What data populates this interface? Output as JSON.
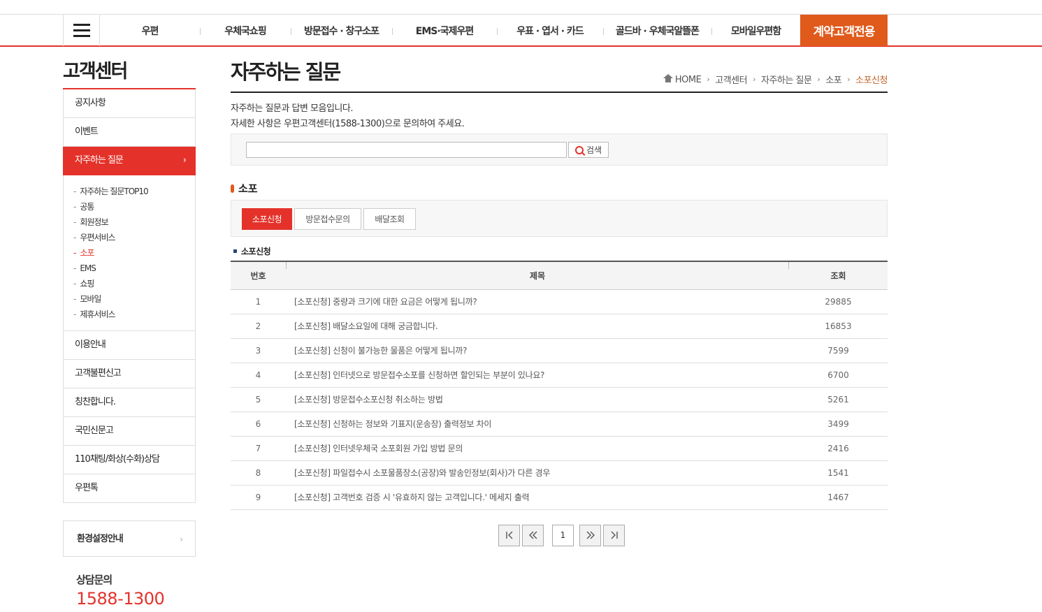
{
  "topnav": {
    "items": [
      "우편",
      "우체국쇼핑",
      "방문접수 · 창구소포",
      "EMS·국제우편",
      "우표 · 엽서 · 카드",
      "골드바 · 우체국알뜰폰",
      "모바일우편함",
      "계약고객전용"
    ]
  },
  "sidebar": {
    "title": "고객센터",
    "items_top": [
      "공지사항",
      "이벤트",
      "자주하는 질문"
    ],
    "sub_items": [
      "자주하는 질문TOP10",
      "공통",
      "회원정보",
      "우편서비스",
      "소포",
      "EMS",
      "쇼핑",
      "모바일",
      "제휴서비스"
    ],
    "items_bottom": [
      "이용안내",
      "고객불편신고",
      "칭찬합니다.",
      "국민신문고",
      "110채팅/화상(수화)상담",
      "우편톡"
    ],
    "env_label": "환경설정안내",
    "consult_label": "상담문의",
    "consult_phone": "1588-1300"
  },
  "main": {
    "title": "자주하는 질문",
    "breadcrumb": [
      "HOME",
      "고객센터",
      "자주하는 질문",
      "소포",
      "소포신청"
    ],
    "intro_1": "자주하는 질문과 답변 모음입니다.",
    "intro_2": "자세한 사항은 우편고객센터(1588-1300)으로 문의하여 주세요.",
    "search": {
      "value": "",
      "button": "검색"
    },
    "section": "소포",
    "tabs": [
      "소포신청",
      "방문접수문의",
      "배달조회"
    ],
    "subsection": "소포신청",
    "table": {
      "headers": [
        "번호",
        "제목",
        "조회"
      ],
      "rows": [
        {
          "num": "1",
          "subject": "[소포신청] 중량과 크기에 대한 요금은 어떻게 됩니까?",
          "views": "29885"
        },
        {
          "num": "2",
          "subject": "[소포신청] 배달소요일에 대해 궁금합니다.",
          "views": "16853"
        },
        {
          "num": "3",
          "subject": "[소포신청] 신청이 불가능한 물품은 어떻게 됩니까?",
          "views": "7599"
        },
        {
          "num": "4",
          "subject": "[소포신청] 인터넷으로 방문접수소포를 신청하면 할인되는 부분이 있나요?",
          "views": "6700"
        },
        {
          "num": "5",
          "subject": "[소포신청] 방문접수소포신청 취소하는 방법",
          "views": "5261"
        },
        {
          "num": "6",
          "subject": "[소포신청] 신청하는 정보와 기표지(운송장) 출력정보 차이",
          "views": "3499"
        },
        {
          "num": "7",
          "subject": "[소포신청] 인터넷우체국 소포회원 가입 방법 문의",
          "views": "2416"
        },
        {
          "num": "8",
          "subject": "[소포신청] 파일접수시 소포물품장소(공장)와 발송인정보(회사)가 다른 경우",
          "views": "1541"
        },
        {
          "num": "9",
          "subject": "[소포신청] 고객번호 검증 시 '유효하지 않는 고객입니다.' 메세지 출력",
          "views": "1467"
        }
      ]
    },
    "pagination": {
      "current": "1"
    }
  }
}
